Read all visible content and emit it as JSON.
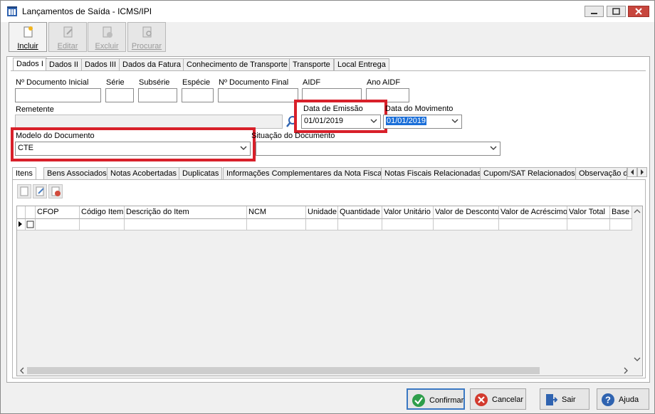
{
  "window": {
    "title": "Lançamentos de Saída - ICMS/IPI"
  },
  "toolbar": {
    "incluir": "Incluir",
    "editar": "Editar",
    "excluir": "Excluir",
    "procurar": "Procurar"
  },
  "top_tabs": [
    "Dados I",
    "Dados II",
    "Dados III",
    "Dados da Fatura",
    "Conhecimento de Transporte",
    "Transporte",
    "Local Entrega"
  ],
  "form": {
    "n_doc_inicial_label": "Nº Documento Inicial",
    "serie_label": "Série",
    "subserie_label": "Subsérie",
    "especie_label": "Espécie",
    "n_doc_final_label": "Nº Documento Final",
    "aidf_label": "AIDF",
    "ano_aidf_label": "Ano AIDF",
    "remetente_label": "Remetente",
    "data_emissao_label": "Data de Emissão",
    "data_emissao_value": "01/01/2019",
    "data_movimento_label": "Data do Movimento",
    "data_movimento_value": "01/01/2019",
    "modelo_label": "Modelo do Documento",
    "modelo_value": "CTE",
    "situacao_label": "Situação do Documento"
  },
  "mid_tabs": [
    "Itens",
    "Bens Associados",
    "Notas Acobertadas",
    "Duplicatas",
    "Informações Complementares da Nota Fiscal",
    "Notas Fiscais Relacionadas",
    "Cupom/SAT Relacionados",
    "Observação d"
  ],
  "grid": {
    "columns": [
      "CFOP",
      "Código Item",
      "Descrição do Item",
      "NCM",
      "Unidade",
      "Quantidade",
      "Valor Unitário",
      "Valor de Desconto",
      "Valor de Acréscimo",
      "Valor Total",
      "Base c"
    ]
  },
  "footer": {
    "confirmar": "Confirmar",
    "cancelar": "Cancelar",
    "sair": "Sair",
    "ajuda": "Ajuda"
  },
  "colors": {
    "highlight": "#d8202a",
    "accent": "#1a6ed8"
  }
}
